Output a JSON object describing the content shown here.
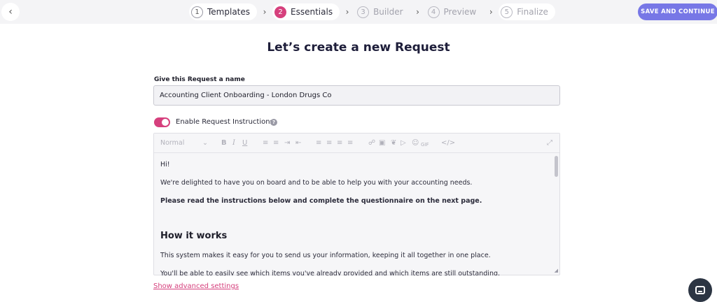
{
  "header": {
    "back_icon": "chevron-left-icon",
    "steps": [
      {
        "num": "1",
        "label": "Templates"
      },
      {
        "num": "2",
        "label": "Essentials"
      },
      {
        "num": "3",
        "label": "Builder"
      },
      {
        "num": "4",
        "label": "Preview"
      },
      {
        "num": "5",
        "label": "Finalize"
      }
    ],
    "save_label": "SAVE AND CONTINUE"
  },
  "main": {
    "title": "Let’s create a new Request",
    "name_label": "Give this Request a name",
    "name_value": "Accounting Client Onboarding - London Drugs Co",
    "instructions_toggle_label": "Enable Request Instructions",
    "help_icon_glyph": "?"
  },
  "editor": {
    "format_select": "Normal",
    "toolbar_icons": [
      "bold-icon",
      "italic-icon",
      "underline-icon",
      "bullet-list-icon",
      "numbered-list-icon",
      "indent-icon",
      "outdent-icon",
      "align-left-icon",
      "align-center-icon",
      "align-right-icon",
      "align-justify-icon",
      "link-icon",
      "image-icon",
      "attachment-icon",
      "video-icon",
      "emoji-icon",
      "gif-icon",
      "code-icon",
      "fullscreen-icon"
    ],
    "content": {
      "greeting": "Hi!",
      "para1": "We're delighted to have you on board and to be able to help you with your accounting needs.",
      "para2": "Please read the instructions below and complete the questionnaire on the next page.",
      "heading": "How it works",
      "para3": "This system makes it easy for you to send us your information, keeping it all together in one place.",
      "para4": "You'll be able to easily see which items you've already provided and which items are still outstanding."
    }
  },
  "footer": {
    "advanced_link": "Show advanced settings"
  },
  "colors": {
    "accent": "#d6407d",
    "primary_button": "#7777e6",
    "chat_button": "#2c3543"
  }
}
